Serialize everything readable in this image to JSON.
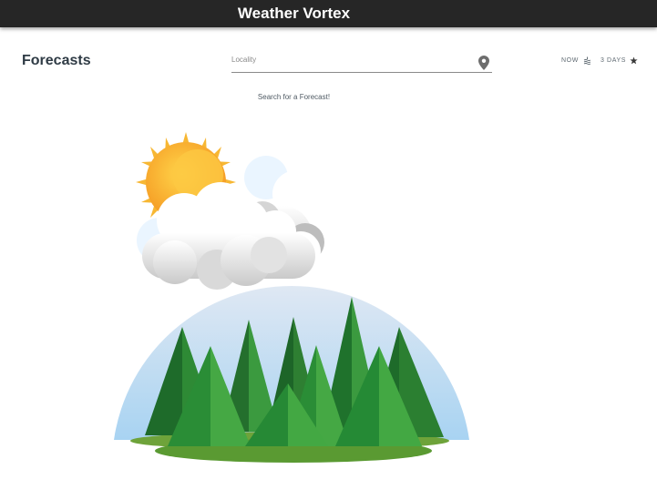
{
  "app": {
    "title": "Weather Vortex"
  },
  "page": {
    "title": "Forecasts"
  },
  "search": {
    "placeholder": "Locality",
    "value": ""
  },
  "tabs": [
    {
      "label": "NOW",
      "icon": "waves-icon"
    },
    {
      "label": "3 DAYS",
      "icon": "star-icon"
    }
  ],
  "main": {
    "hint": "Search for a Forecast!"
  },
  "colors": {
    "appbar": "#262626",
    "sky_top": "#dfe8f3",
    "sky_bottom": "#a8d3f2",
    "sun": "#f7b733",
    "ground": "#6ea33a",
    "tree_dark": "#1e6b2a",
    "tree_light": "#3f9a3c"
  }
}
